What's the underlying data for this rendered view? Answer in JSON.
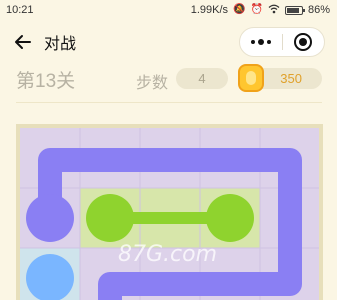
{
  "status_bar": {
    "time": "10:21",
    "network_speed": "1.99K/s",
    "battery": "86%"
  },
  "nav": {
    "title": "对战"
  },
  "level": {
    "title": "第13关",
    "steps_label": "步数",
    "steps_value": "4",
    "coins": "350"
  },
  "game": {
    "watermark": "87G.com",
    "pairs": [
      {
        "name": "purple",
        "color": "#8a7ff3"
      },
      {
        "name": "green",
        "color": "#8fd32e"
      },
      {
        "name": "blue",
        "color": "#7ab6ff"
      }
    ],
    "highlight_colors": {
      "purple": "#d9cde9",
      "green": "#d7e6aa",
      "blue": "#cfe4ec"
    }
  }
}
